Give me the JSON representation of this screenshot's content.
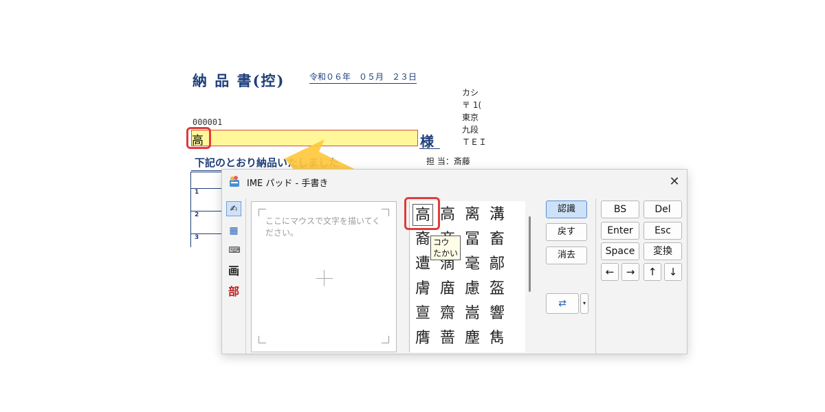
{
  "document": {
    "title": "納 品 書(控)",
    "date": "令和０６年　０５月　２３日",
    "company_lines": [
      "カシ",
      "〒 1(",
      "東京",
      "九段",
      "ＴＥＩ"
    ],
    "customer_code": "000001",
    "customer_name_input": "高",
    "honorific": "様",
    "notice": "下記のとおり納品いたしました",
    "staff": "担 当：斎藤",
    "row_numbers": [
      "1",
      "2",
      "3"
    ]
  },
  "ime_pad": {
    "title": "IME パッド - 手書き",
    "close_label": "✕",
    "toolbar": {
      "handwriting_icon": "✍",
      "char_list_icon": "▦",
      "soft_keyboard_icon": "⌨",
      "stroke_count_label": "画",
      "radical_label": "部"
    },
    "draw_hint": "ここにマウスで文字を描いてください。",
    "candidates": [
      [
        "高",
        "高",
        "离",
        "溝"
      ],
      [
        "裔",
        "商",
        "冨",
        "畜"
      ],
      [
        "遭",
        "滴",
        "毫",
        "鄗"
      ],
      [
        "膚",
        "庿",
        "慮",
        "盔"
      ],
      [
        "亶",
        "齋",
        "嵩",
        "響"
      ],
      [
        "膺",
        "蔷",
        "塵",
        "雋"
      ]
    ],
    "tooltip_reading_on": "コウ",
    "tooltip_reading_kun": "たかい",
    "command_buttons": {
      "recognize": "認識",
      "back": "戻す",
      "clear": "消去"
    },
    "options_icon": "⇄",
    "options_dropdown": "▾",
    "keys": {
      "bs": "BS",
      "del": "Del",
      "enter": "Enter",
      "esc": "Esc",
      "space": "Space",
      "convert": "変換",
      "left": "←",
      "right": "→",
      "up": "↑",
      "down": "↓"
    }
  },
  "colors": {
    "accent_red": "#e03b3b",
    "arrow_yellow": "#ffc83d",
    "doc_blue": "#1f3f7a",
    "field_yellow": "#fff79a"
  }
}
